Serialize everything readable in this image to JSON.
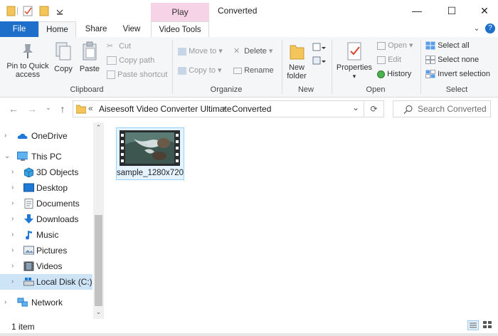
{
  "window": {
    "title": "Converted",
    "contextual_tab": "Play",
    "controls": {
      "minimize": "—",
      "maximize": "☐",
      "close": "✕"
    }
  },
  "tabs": {
    "file": "File",
    "home": "Home",
    "share": "Share",
    "view": "View",
    "video_tools": "Video Tools"
  },
  "ribbon": {
    "clipboard": {
      "label": "Clipboard",
      "pin": "Pin to Quick access",
      "copy": "Copy",
      "paste": "Paste",
      "cut": "Cut",
      "copy_path": "Copy path",
      "paste_shortcut": "Paste shortcut"
    },
    "organize": {
      "label": "Organize",
      "move_to": "Move to",
      "copy_to": "Copy to",
      "delete": "Delete",
      "rename": "Rename"
    },
    "new": {
      "label": "New",
      "new_folder": "New folder"
    },
    "open": {
      "label": "Open",
      "properties": "Properties",
      "open": "Open",
      "edit": "Edit",
      "history": "History"
    },
    "select": {
      "label": "Select",
      "select_all": "Select all",
      "select_none": "Select none",
      "invert": "Invert selection"
    }
  },
  "address": {
    "breadcrumb_sep": "«",
    "crumbs": [
      "Aiseesoft Video Converter Ultimate",
      "Converted"
    ],
    "search_placeholder": "Search Converted"
  },
  "nav": {
    "items": [
      {
        "label": "OneDrive",
        "icon": "cloud-icon"
      },
      {
        "label": "This PC",
        "icon": "monitor-icon"
      },
      {
        "label": "3D Objects",
        "icon": "cube-icon"
      },
      {
        "label": "Desktop",
        "icon": "desktop-icon"
      },
      {
        "label": "Documents",
        "icon": "document-icon"
      },
      {
        "label": "Downloads",
        "icon": "download-arrow-icon"
      },
      {
        "label": "Music",
        "icon": "music-note-icon"
      },
      {
        "label": "Pictures",
        "icon": "picture-icon"
      },
      {
        "label": "Videos",
        "icon": "film-icon"
      },
      {
        "label": "Local Disk (C:)",
        "icon": "drive-icon"
      },
      {
        "label": "Network",
        "icon": "network-icon"
      }
    ]
  },
  "files": [
    {
      "name": "sample_1280x720",
      "type": "video-thumbnail"
    }
  ],
  "status": {
    "count": "1 item"
  },
  "colors": {
    "accent": "#1e6fc9",
    "contextual_tab": "#f7d3e8",
    "selection": "#cde4f7",
    "ribbon_bg": "#f5f6f7"
  }
}
